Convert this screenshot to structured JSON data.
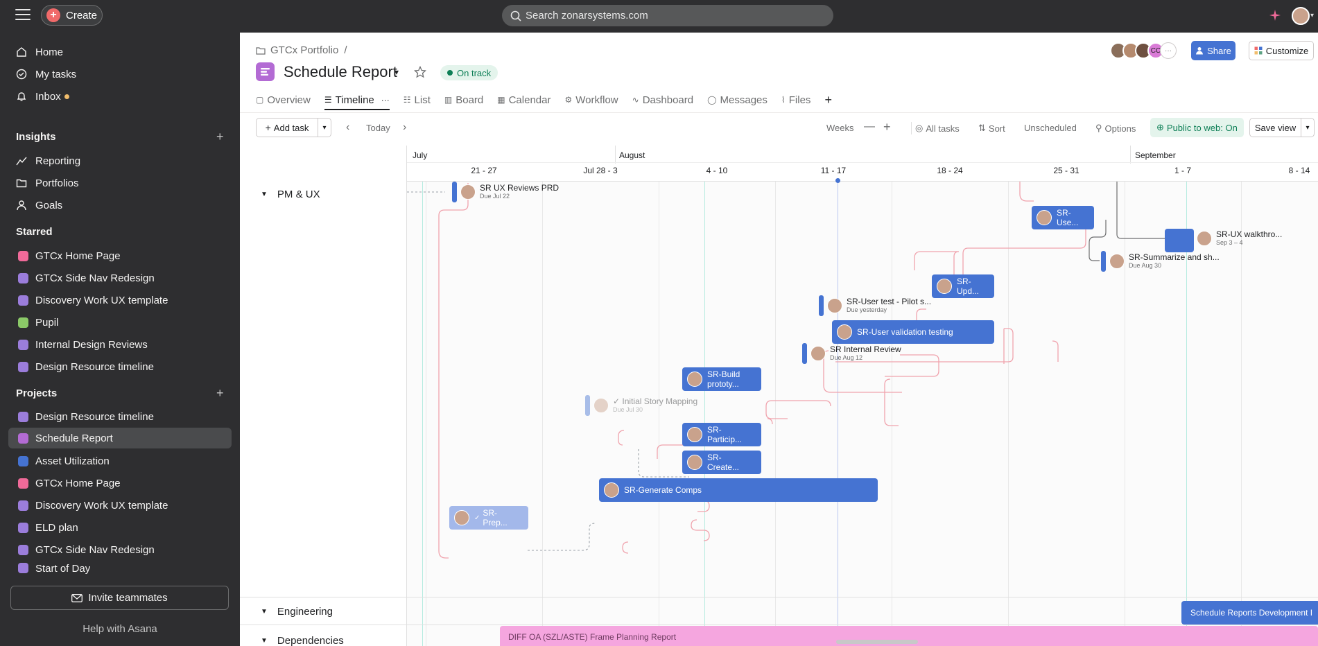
{
  "topbar": {
    "create_label": "Create",
    "search_placeholder": "Search zonarsystems.com"
  },
  "sidebar": {
    "nav": [
      {
        "label": "Home",
        "icon": "home-icon"
      },
      {
        "label": "My tasks",
        "icon": "check-circle-icon"
      },
      {
        "label": "Inbox",
        "icon": "bell-icon"
      }
    ],
    "insights_title": "Insights",
    "insights": [
      {
        "label": "Reporting",
        "icon": "chart-line-icon"
      },
      {
        "label": "Portfolios",
        "icon": "folder-icon"
      },
      {
        "label": "Goals",
        "icon": "person-icon"
      }
    ],
    "starred_title": "Starred",
    "starred": [
      {
        "label": "GTCx Home Page",
        "color": "#f06a99"
      },
      {
        "label": "GTCx Side Nav Redesign",
        "color": "#9b7ddb"
      },
      {
        "label": "Discovery Work UX template",
        "color": "#9b7ddb"
      },
      {
        "label": "Pupil",
        "color": "#8bc968"
      },
      {
        "label": "Internal Design Reviews",
        "color": "#9b7ddb"
      },
      {
        "label": "Design Resource timeline",
        "color": "#9b7ddb"
      }
    ],
    "projects_title": "Projects",
    "projects": [
      {
        "label": "Design Resource timeline",
        "color": "#9b7ddb"
      },
      {
        "label": "Schedule Report",
        "color": "#b36bd4"
      },
      {
        "label": "Asset Utilization",
        "color": "#4573d2"
      },
      {
        "label": "GTCx Home Page",
        "color": "#f06a99"
      },
      {
        "label": "Discovery Work UX template",
        "color": "#9b7ddb"
      },
      {
        "label": "ELD plan",
        "color": "#9b7ddb"
      },
      {
        "label": "GTCx Side Nav Redesign",
        "color": "#9b7ddb"
      },
      {
        "label": "Start of Day",
        "color": "#9b7ddb"
      }
    ],
    "invite_label": "Invite teammates",
    "help_label": "Help with Asana"
  },
  "header": {
    "breadcrumb": "GTCx Portfolio",
    "breadcrumb_sep": "/",
    "title": "Schedule Report",
    "status": "On track",
    "member_extra": "CC",
    "share_label": "Share",
    "customize_label": "Customize",
    "tabs": [
      "Overview",
      "Timeline",
      "List",
      "Board",
      "Calendar",
      "Workflow",
      "Dashboard",
      "Messages",
      "Files"
    ]
  },
  "toolbar": {
    "add_task": "Add task",
    "today": "Today",
    "weeks": "Weeks",
    "all_tasks": "All tasks",
    "sort": "Sort",
    "unscheduled": "Unscheduled",
    "options": "Options",
    "public": "Public to web: On",
    "save_view": "Save view"
  },
  "timeline": {
    "months": [
      "July",
      "August",
      "September"
    ],
    "weeks": [
      "21 - 27",
      "Jul 28 - 3",
      "4 - 10",
      "11 - 17",
      "18 - 24",
      "25 - 31",
      "1 - 7",
      "8 - 14"
    ],
    "groups": [
      "PM & UX",
      "Engineering",
      "Dependencies"
    ],
    "milestones": [
      {
        "title": "SR UX Reviews PRD",
        "due": "Due Jul 22"
      },
      {
        "title": "SR-Summarize and sh...",
        "due": "Due Aug 30"
      },
      {
        "title": "SR-User test - Pilot s...",
        "due": "Due yesterday"
      },
      {
        "title": "SR Internal Review",
        "due": "Due Aug 12"
      },
      {
        "title": "Initial Story Mapping",
        "due": "Due Jul 30"
      },
      {
        "title": "SR-UX walkthro...",
        "due": "Sep 3 – 4"
      }
    ],
    "bars": [
      {
        "label": "SR-\nUse..."
      },
      {
        "label": "SR-\nUpd..."
      },
      {
        "label": "SR-User validation testing"
      },
      {
        "label": "SR-Build\nprototy..."
      },
      {
        "label": "SR-\nParticip..."
      },
      {
        "label": "SR-\nCreate..."
      },
      {
        "label": "SR-Generate Comps"
      },
      {
        "label": "SR-\nPrep..."
      },
      {
        "label": "Schedule Reports Development I"
      }
    ],
    "dependency_bar": "DIFF OA (SZL/ASTE) Frame Planning Report"
  }
}
